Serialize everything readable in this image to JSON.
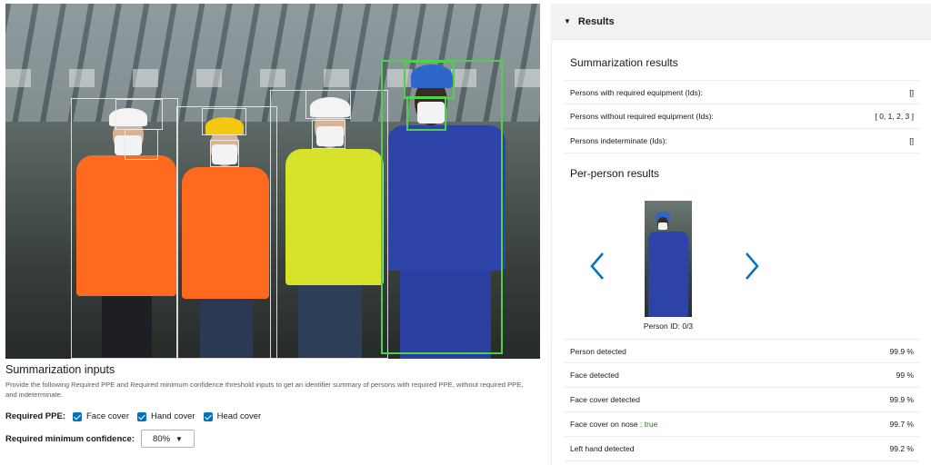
{
  "left": {
    "inputs_title": "Summarization inputs",
    "inputs_desc": "Provide the following Required PPE and Required minimum confidence threshold inputs to get an identifier summary of persons with required PPE, without required PPE, and indeterminate.",
    "required_ppe_label": "Required PPE:",
    "ppe_options": [
      {
        "label": "Face cover",
        "checked": true
      },
      {
        "label": "Hand cover",
        "checked": true
      },
      {
        "label": "Head cover",
        "checked": true
      }
    ],
    "confidence_label": "Required minimum confidence:",
    "confidence_value": "80%"
  },
  "right": {
    "results_header": "Results",
    "summary_title": "Summarization results",
    "summary_rows": [
      {
        "label": "Persons with required equipment (Ids):",
        "value": "[]"
      },
      {
        "label": "Persons without required equipment (Ids):",
        "value": "[ 0, 1, 2, 3 ]"
      },
      {
        "label": "Persons indeterminate (Ids):",
        "value": "[]"
      }
    ],
    "per_person_title": "Per-person results",
    "person_id": "Person ID: 0/3",
    "detail_rows": [
      {
        "label": "Person detected",
        "value": "99.9 %"
      },
      {
        "label": "Face detected",
        "value": "99 %"
      },
      {
        "label": "Face cover detected",
        "value": "99.9 %"
      },
      {
        "label": "Face cover on nose : ",
        "extra": "true",
        "value": "99.7 %"
      },
      {
        "label": "Left hand detected",
        "value": "99.2 %"
      }
    ]
  },
  "colors": {
    "accent": "#0073bb",
    "bbox_green": "#4fd14f",
    "true_text": "#1d8102"
  },
  "icons": {
    "collapse": "caret-down-icon",
    "prev": "chevron-left-icon",
    "next": "chevron-right-icon",
    "select_caret": "caret-down-icon"
  }
}
